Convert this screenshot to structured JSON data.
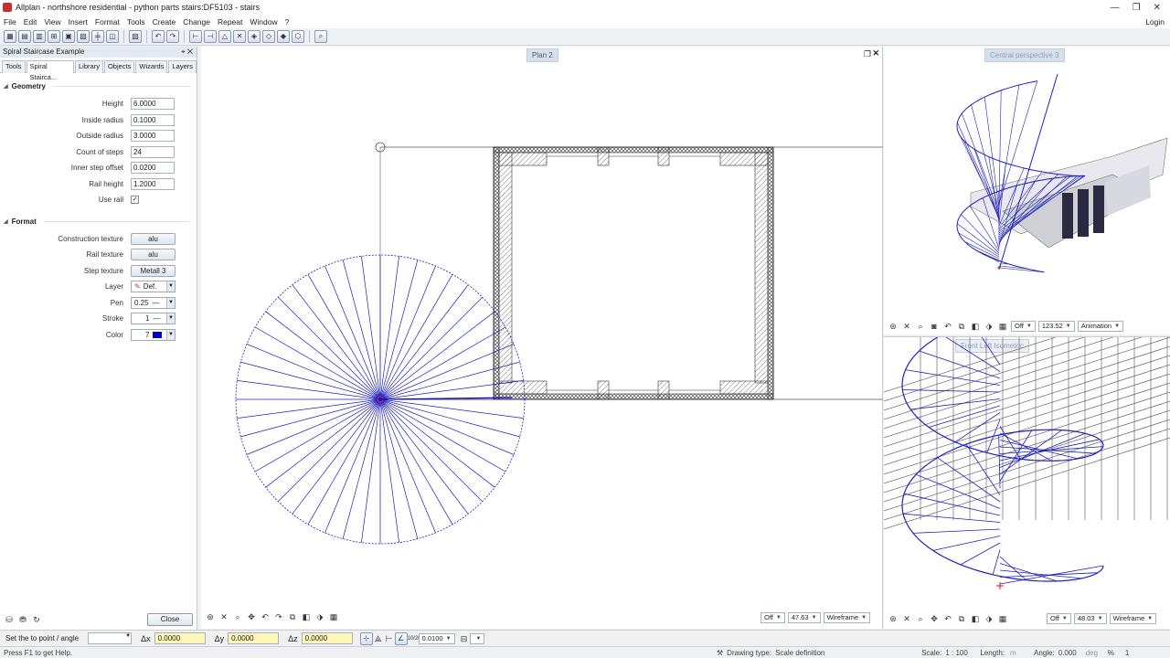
{
  "window": {
    "title": "Allplan - northshore residential - python parts stairs:DF5103 - stairs"
  },
  "menu": [
    "File",
    "Edit",
    "View",
    "Insert",
    "Format",
    "Tools",
    "Create",
    "Change",
    "Repeat",
    "Window",
    "?"
  ],
  "login": "Login",
  "panel": {
    "title": "Spiral Staircase Example",
    "tabs": [
      "Tools",
      "Spiral Stairca...",
      "Library",
      "Objects",
      "Wizards",
      "Layers"
    ],
    "geometry_header": "Geometry",
    "geometry": [
      {
        "label": "Height",
        "value": "6.0000"
      },
      {
        "label": "Inside radius",
        "value": "0.1000"
      },
      {
        "label": "Outside radius",
        "value": "3.0000"
      },
      {
        "label": "Count of steps",
        "value": "24"
      },
      {
        "label": "Inner step offset",
        "value": "0.0200"
      },
      {
        "label": "Rail height",
        "value": "1.2000"
      }
    ],
    "use_rail_label": "Use rail",
    "use_rail_checked": "✓",
    "format_header": "Format",
    "construction_texture": {
      "label": "Construction texture",
      "value": "alu"
    },
    "rail_texture": {
      "label": "Rail texture",
      "value": "alu"
    },
    "step_texture": {
      "label": "Step texture",
      "value": "Metall 3"
    },
    "layer": {
      "label": "Layer",
      "value": "Def."
    },
    "pen": {
      "label": "Pen",
      "value": "0.25"
    },
    "stroke": {
      "label": "Stroke",
      "value": "1"
    },
    "color": {
      "label": "Color",
      "value": "7",
      "swatch": "#0000c8"
    },
    "close_label": "Close"
  },
  "plan": {
    "title": "Plan 2",
    "off": "Off",
    "scale": "47.63",
    "mode": "Wireframe"
  },
  "persp_top": {
    "title": "Central perspective 3",
    "off": "Off",
    "value": "123.52",
    "mode": "Animation"
  },
  "persp_bottom": {
    "title": "Front Left Isometric",
    "off": "Off",
    "value": "48.03",
    "mode": "Wireframe"
  },
  "inputbar": {
    "prompt": "Set the to point / angle",
    "dx_label": "Δx",
    "dx": "0.0000",
    "dy_label": "Δy",
    "dy": "0.0000",
    "dz_label": "Δz",
    "dz": "0.0000",
    "snap": "0.0100"
  },
  "status": {
    "help": "Press F1 to get Help.",
    "drawing_type_label": "Drawing type:",
    "drawing_type": "Scale definition",
    "scale_label": "Scale:",
    "scale": "1 : 100",
    "length_label": "Length:",
    "length_unit": "m",
    "angle_label": "Angle:",
    "angle": "0.000",
    "angle_unit": "deg",
    "percent": "%",
    "page": "1"
  },
  "colors": {
    "stair_blue": "#2020c0",
    "wall": "#333333",
    "accent": "#d7dfea"
  }
}
